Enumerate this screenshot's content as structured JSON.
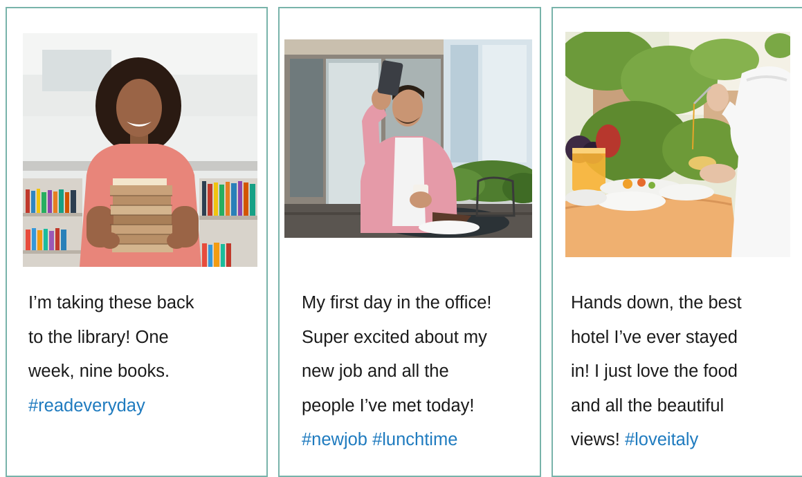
{
  "posts": [
    {
      "image": "student-holding-stack-of-library-books",
      "lines": [
        "I’m taking these back",
        "to the library! One",
        "week, nine books."
      ],
      "hashtag_line": "#readeveryday"
    },
    {
      "image": "man-taking-selfie-at-cafe-table",
      "lines": [
        "My first day in the office!",
        "Super excited about my",
        "new job and all the",
        "people I’ve met today!"
      ],
      "hashtag_line": "#newjob #lunchtime"
    },
    {
      "image": "hotel-breakfast-table-with-fruit",
      "lines": [
        "Hands down, the best",
        "hotel I’ve ever stayed",
        "in! I just love the food",
        "and all the beautiful"
      ],
      "last_line_text": "views! ",
      "hashtag_line": "#loveitaly"
    }
  ],
  "colors": {
    "border": "#78b3aa",
    "hashtag": "#1f7bbf",
    "text": "#1a1a1a"
  }
}
